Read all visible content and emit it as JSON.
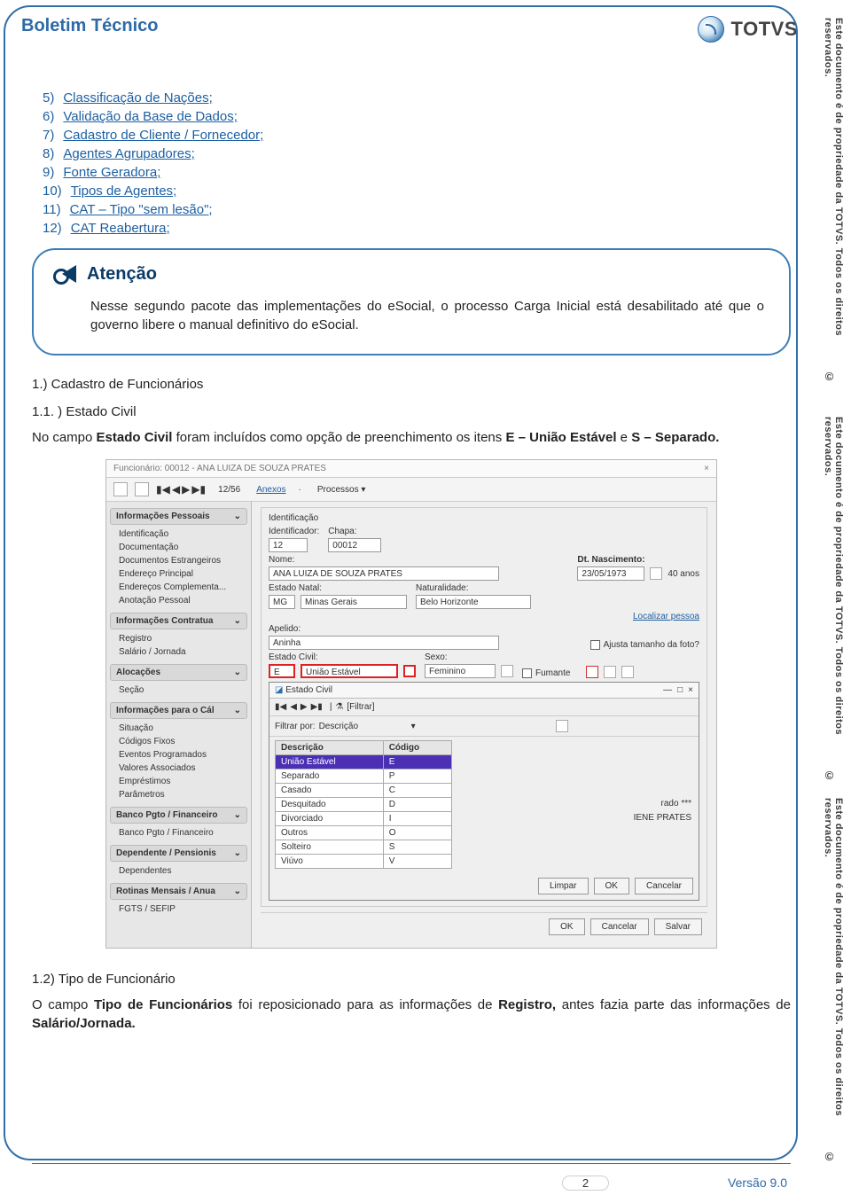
{
  "copyright": "Este documento é de propriedade da TOTVS. Todos os direitos reservados.",
  "header": {
    "title": "Boletim Técnico",
    "brand": "TOTVS"
  },
  "links": [
    {
      "n": "5)",
      "t": "Classificação de Nações;"
    },
    {
      "n": "6)",
      "t": "Validação da Base de Dados;"
    },
    {
      "n": "7)",
      "t": "Cadastro de Cliente / Fornecedor;"
    },
    {
      "n": "8)",
      "t": "Agentes Agrupadores;"
    },
    {
      "n": "9)",
      "t": "Fonte Geradora;"
    },
    {
      "n": "10)",
      "t": "Tipos de Agentes;"
    },
    {
      "n": "11)",
      "t": "CAT – Tipo \"sem lesão\";"
    },
    {
      "n": "12)",
      "t": "CAT Reabertura;"
    }
  ],
  "callout": {
    "title": "Atenção",
    "body": "Nesse segundo pacote das implementações do eSocial, o processo Carga Inicial está desabilitado até que o governo libere o manual definitivo do eSocial."
  },
  "sec1": "1.) Cadastro de Funcionários",
  "sec11": "1.1. ) Estado Civil",
  "para1": "No campo Estado Civil foram incluídos como opção de preenchimento os itens E – União Estável e S – Separado.",
  "sec12": "1.2) Tipo de Funcionário",
  "para2": "O campo Tipo de Funcionários foi reposicionado para as informações de Registro, antes fazia parte das informações de Salário/Jornada.",
  "footer": {
    "page": "2",
    "version": "Versão 9.0"
  },
  "shot": {
    "wtitle": "Funcionário: 00012 - ANA LUIZA DE SOUZA PRATES",
    "pager": "12/56",
    "anexos": "Anexos",
    "processos": "Processos",
    "side": {
      "g1": {
        "h": "Informações Pessoais",
        "items": [
          "Identificação",
          "Documentação",
          "Documentos Estrangeiros",
          "Endereço Principal",
          "Endereços Complementa...",
          "Anotação Pessoal"
        ]
      },
      "g2": {
        "h": "Informações Contratua",
        "items": [
          "Registro",
          "Salário / Jornada"
        ]
      },
      "g3": {
        "h": "Alocações",
        "items": [
          "Seção"
        ]
      },
      "g4": {
        "h": "Informações para o Cál",
        "items": [
          "Situação",
          "Códigos Fixos",
          "Eventos Programados",
          "Valores Associados",
          "Empréstimos",
          "Parâmetros"
        ]
      },
      "g5": {
        "h": "Banco Pgto / Financeiro",
        "items": [
          "Banco Pgto / Financeiro"
        ]
      },
      "g6": {
        "h": "Dependente / Pensionis",
        "items": [
          "Dependentes"
        ]
      },
      "g7": {
        "h": "Rotinas Mensais / Anua",
        "items": [
          "FGTS / SEFIP"
        ]
      }
    },
    "form": {
      "grp": "Identificação",
      "ident": {
        "l": "Identificador:",
        "v": "12"
      },
      "chapa": {
        "l": "Chapa:",
        "v": "00012"
      },
      "nome": {
        "l": "Nome:",
        "v": "ANA LUIZA DE SOUZA PRATES"
      },
      "dtnasc": {
        "l": "Dt. Nascimento:",
        "v": "23/05/1973",
        "age": "40 anos"
      },
      "estN": {
        "l": "Estado Natal:",
        "code": "MG",
        "v": "Minas Gerais"
      },
      "nat": {
        "l": "Naturalidade:",
        "v": "Belo Horizonte"
      },
      "loc": "Localizar pessoa",
      "apelido": {
        "l": "Apelido:",
        "v": "Aninha"
      },
      "ajusta": "Ajusta tamanho da foto?",
      "ecivil": {
        "l": "Estado Civil:",
        "code": "E",
        "v": "União Estável"
      },
      "sexo": {
        "l": "Sexo:",
        "v": "Feminino"
      },
      "fumante": "Fumante"
    },
    "dlg": {
      "title": "Estado Civil",
      "filter_lbl": "Filtrar por:",
      "filter_val": "Descrição",
      "filtrar": "[Filtrar]",
      "cols": [
        "Descrição",
        "Código"
      ],
      "rows": [
        {
          "d": "União Estável",
          "c": "E",
          "sel": true
        },
        {
          "d": "Separado",
          "c": "P"
        },
        {
          "d": "Casado",
          "c": "C"
        },
        {
          "d": "Desquitado",
          "c": "D"
        },
        {
          "d": "Divorciado",
          "c": "I"
        },
        {
          "d": "Outros",
          "c": "O"
        },
        {
          "d": "Solteiro",
          "c": "S"
        },
        {
          "d": "Viúvo",
          "c": "V"
        }
      ],
      "btns": {
        "limpar": "Limpar",
        "ok": "OK",
        "cancelar": "Cancelar"
      }
    },
    "extra": {
      "a": "rado ***",
      "b": "IENE PRATES"
    },
    "footer_btns": {
      "ok": "OK",
      "cancelar": "Cancelar",
      "salvar": "Salvar"
    }
  }
}
